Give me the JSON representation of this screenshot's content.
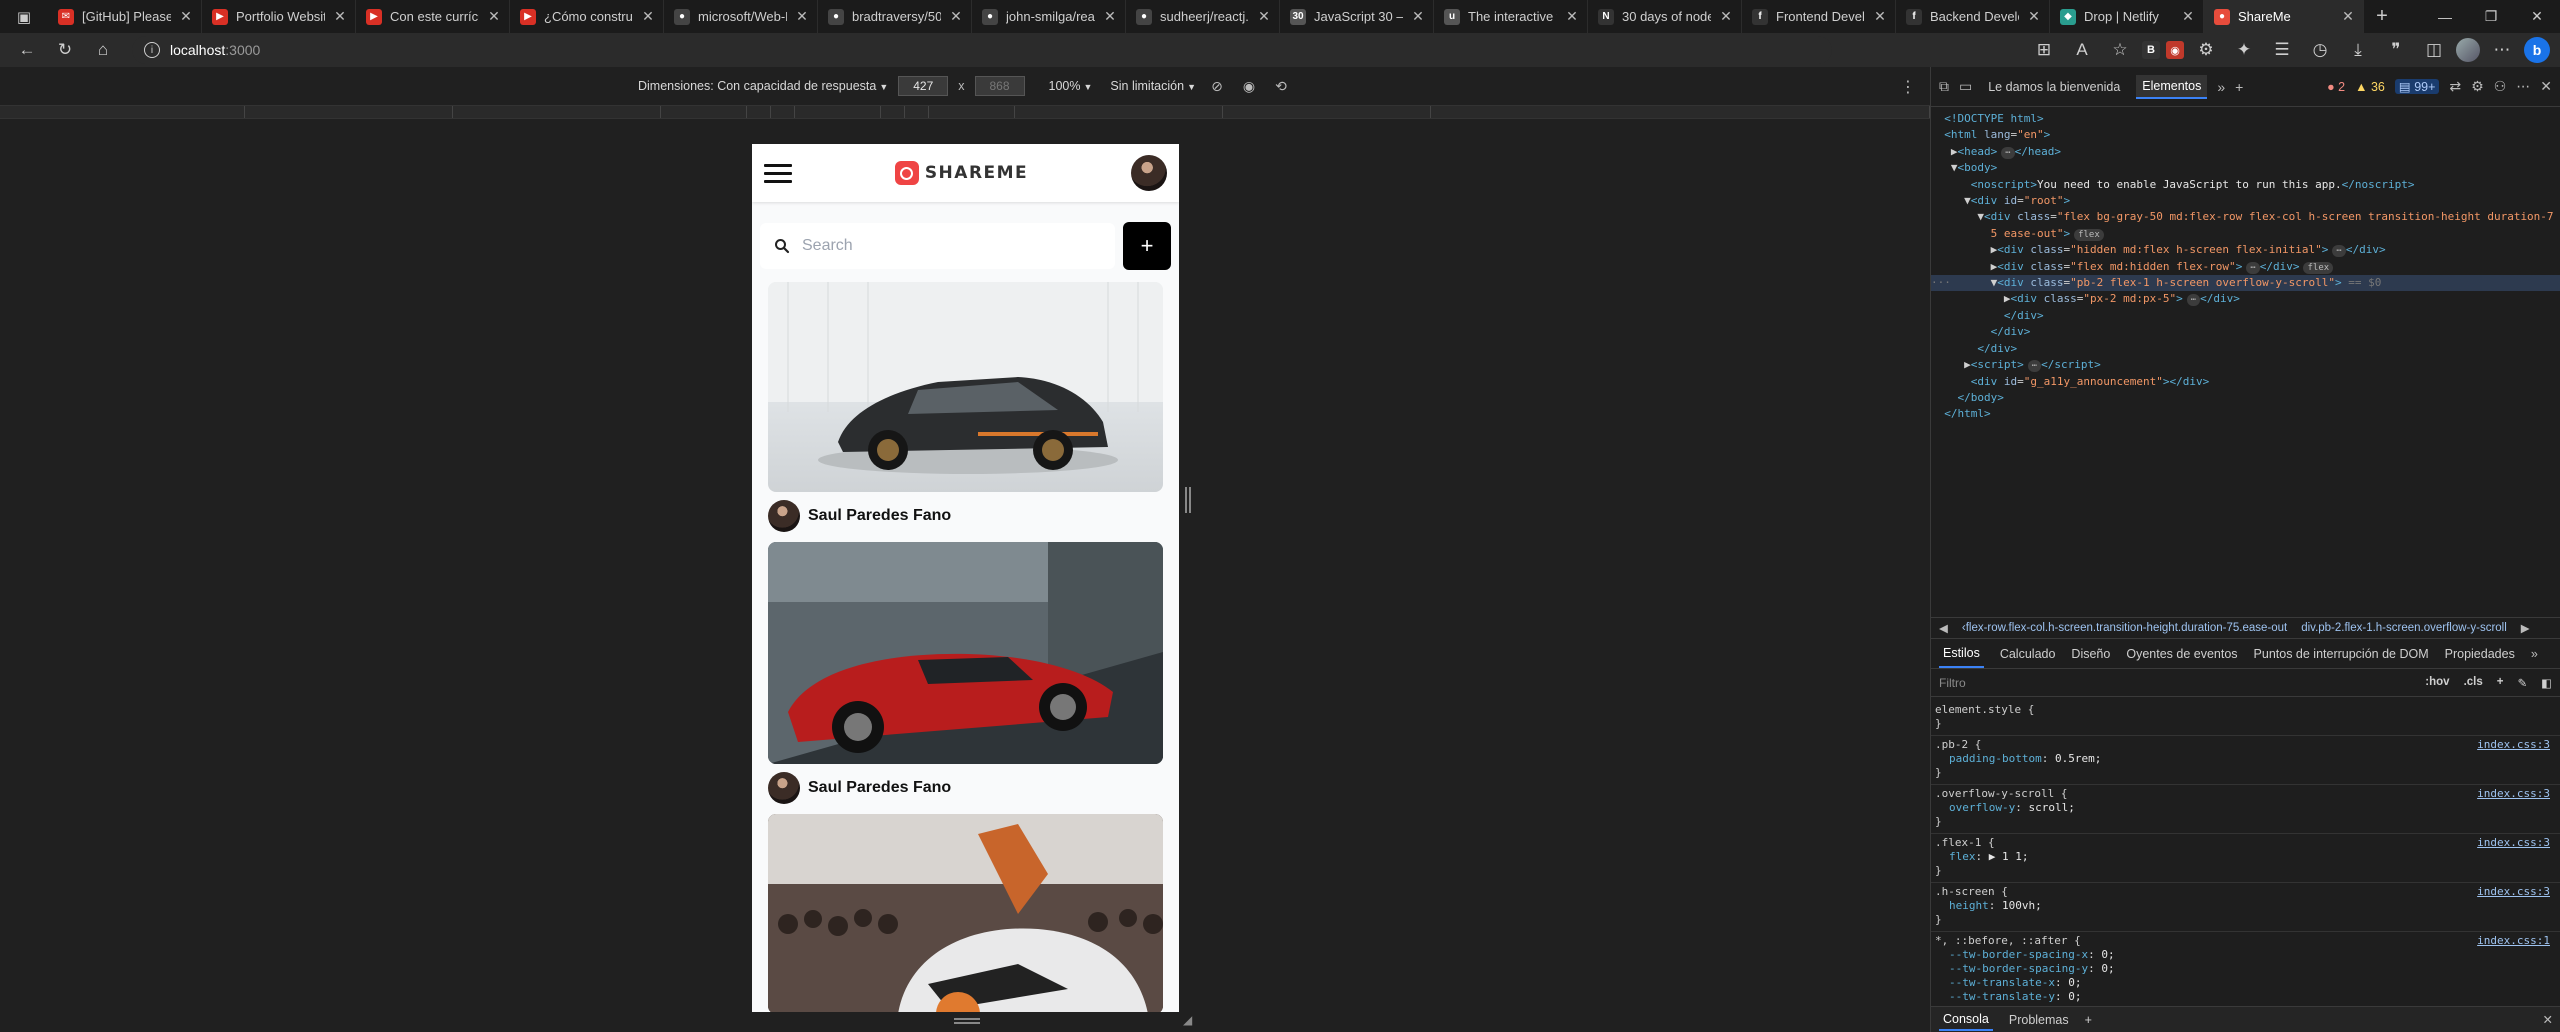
{
  "browser": {
    "tabs": [
      {
        "title": "[GitHub] Please ...",
        "color": "#d93025",
        "glyph": "✉"
      },
      {
        "title": "Portfolio Website...",
        "color": "#d93025",
        "glyph": "▶"
      },
      {
        "title": "Con este currícul...",
        "color": "#d93025",
        "glyph": "▶"
      },
      {
        "title": "¿Cómo construir...",
        "color": "#d93025",
        "glyph": "▶"
      },
      {
        "title": "microsoft/Web-D...",
        "color": "#444",
        "glyph": "●"
      },
      {
        "title": "bradtraversy/50...",
        "color": "#444",
        "glyph": "●"
      },
      {
        "title": "john-smilga/rea...",
        "color": "#444",
        "glyph": "●"
      },
      {
        "title": "sudheerj/reactj...",
        "color": "#444",
        "glyph": "●"
      },
      {
        "title": "JavaScript 30 —...",
        "color": "#555",
        "glyph": "30"
      },
      {
        "title": "The interactive w...",
        "color": "#555",
        "glyph": "u"
      },
      {
        "title": "30 days of node...",
        "color": "#333",
        "glyph": "N"
      },
      {
        "title": "Frontend Develo...",
        "color": "#333",
        "glyph": "f"
      },
      {
        "title": "Backend Develo...",
        "color": "#333",
        "glyph": "f"
      },
      {
        "title": "Drop | Netlify",
        "color": "#2a9d8f",
        "glyph": "◆"
      },
      {
        "title": "ShareMe",
        "color": "#e74c3c",
        "glyph": "●",
        "active": true
      }
    ],
    "address": {
      "host": "localhost",
      "port": ":3000"
    }
  },
  "device_toolbar": {
    "dimensions_label": "Dimensiones: Con capacidad de respuesta",
    "width": "427",
    "height": "868",
    "zoom": "100%",
    "throttle": "Sin limitación"
  },
  "app": {
    "logo_text": "SHAREME",
    "search_placeholder": "Search",
    "add_label": "+",
    "pins": [
      {
        "author": "Saul Paredes Fano"
      },
      {
        "author": "Saul Paredes Fano"
      },
      {
        "author": ""
      }
    ]
  },
  "devtools": {
    "tabs": {
      "welcome": "Le damos la bienvenida",
      "elements": "Elementos"
    },
    "counts": {
      "errors": "2",
      "warnings": "36",
      "info": "99+"
    },
    "breadcrumbs": [
      "‹flex-row.flex-col.h-screen.transition-height.duration-75.ease-out",
      "div.pb-2.flex-1.h-screen.overflow-y-scroll"
    ],
    "styles_tabs": [
      "Estilos",
      "Calculado",
      "Diseño",
      "Oyentes de eventos",
      "Puntos de interrupción de DOM",
      "Propiedades"
    ],
    "filter_placeholder": "Filtro",
    "filter_buttons": [
      ":hov",
      ".cls"
    ],
    "rules": [
      {
        "selector": "element.style {",
        "source": "",
        "decls": []
      },
      {
        "selector": ".pb-2 {",
        "source": "index.css:3",
        "decls": [
          [
            "padding-bottom",
            "0.5rem;"
          ]
        ]
      },
      {
        "selector": ".overflow-y-scroll {",
        "source": "index.css:3",
        "decls": [
          [
            "overflow-y",
            "scroll;"
          ]
        ]
      },
      {
        "selector": ".flex-1 {",
        "source": "index.css:3",
        "decls": [
          [
            "flex",
            "▶ 1 1;"
          ]
        ]
      },
      {
        "selector": ".h-screen {",
        "source": "index.css:3",
        "decls": [
          [
            "height",
            "100vh;"
          ]
        ]
      },
      {
        "selector": "*, ::before, ::after {",
        "source": "index.css:1",
        "decls": [
          [
            "--tw-border-spacing-x",
            "0;"
          ],
          [
            "--tw-border-spacing-y",
            "0;"
          ],
          [
            "--tw-translate-x",
            "0;"
          ],
          [
            "--tw-translate-y",
            "0;"
          ]
        ]
      }
    ],
    "console_tabs": [
      "Consola",
      "Problemas"
    ]
  }
}
